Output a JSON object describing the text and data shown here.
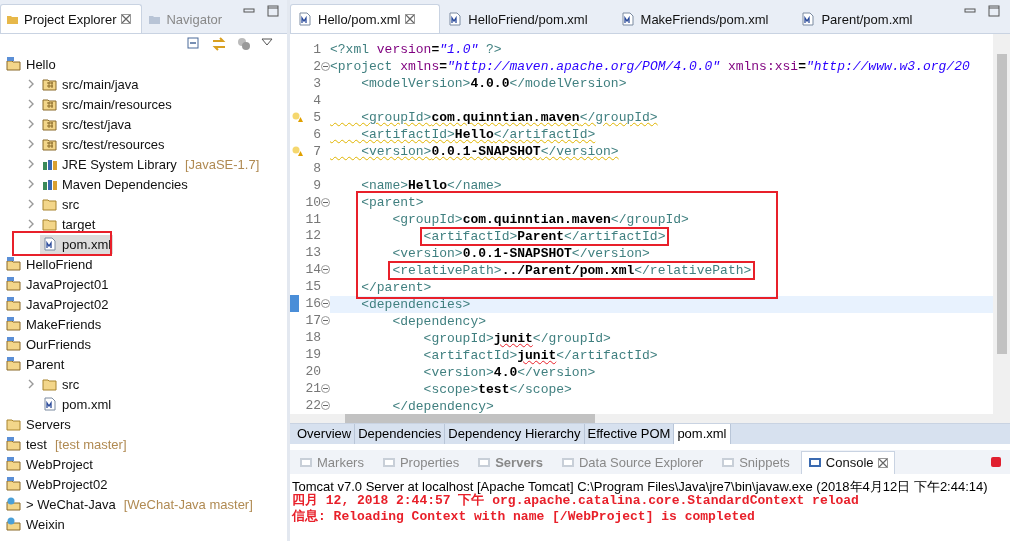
{
  "explorer": {
    "tabs": [
      {
        "label": "Project Explorer",
        "selected": true
      },
      {
        "label": "Navigator",
        "selected": false
      }
    ],
    "tree": [
      {
        "label": "Hello",
        "kind": "project",
        "children": [
          {
            "label": "src/main/java",
            "kind": "package",
            "collapsed_arrow": true
          },
          {
            "label": "src/main/resources",
            "kind": "package",
            "collapsed_arrow": true
          },
          {
            "label": "src/test/java",
            "kind": "package",
            "collapsed_arrow": true
          },
          {
            "label": "src/test/resources",
            "kind": "package",
            "collapsed_arrow": true
          },
          {
            "label": "JRE System Library",
            "decoration": "[JavaSE-1.7]",
            "kind": "library",
            "collapsed_arrow": true
          },
          {
            "label": "Maven Dependencies",
            "kind": "library",
            "collapsed_arrow": true
          },
          {
            "label": "src",
            "kind": "folder",
            "collapsed_arrow": true
          },
          {
            "label": "target",
            "kind": "folder",
            "collapsed_arrow": true
          },
          {
            "label": "pom.xml",
            "kind": "file",
            "selected": true,
            "boxed": true
          }
        ]
      },
      {
        "label": "HelloFriend",
        "kind": "project"
      },
      {
        "label": "JavaProject01",
        "kind": "project"
      },
      {
        "label": "JavaProject02",
        "kind": "project"
      },
      {
        "label": "MakeFriends",
        "kind": "project"
      },
      {
        "label": "OurFriends",
        "kind": "project"
      },
      {
        "label": "Parent",
        "kind": "project",
        "children": [
          {
            "label": "src",
            "kind": "folder",
            "collapsed_arrow": true
          },
          {
            "label": "pom.xml",
            "kind": "file"
          }
        ]
      },
      {
        "label": "Servers",
        "kind": "folder"
      },
      {
        "label": "test",
        "decoration": "[test master]",
        "kind": "project"
      },
      {
        "label": "WebProject",
        "kind": "project"
      },
      {
        "label": "WebProject02",
        "kind": "project"
      },
      {
        "label": "> WeChat-Java",
        "decoration": "[WeChat-Java master]",
        "kind": "web"
      },
      {
        "label": "Weixin",
        "kind": "web"
      }
    ]
  },
  "editor": {
    "tabs": [
      {
        "label": "Hello/pom.xml",
        "selected": true
      },
      {
        "label": "HelloFriend/pom.xml",
        "selected": false
      },
      {
        "label": "MakeFriends/pom.xml",
        "selected": false
      },
      {
        "label": "Parent/pom.xml",
        "selected": false
      }
    ],
    "lines": [
      {
        "number": "1",
        "tokens": [
          {
            "kind": "tag",
            "text": "<?xml "
          },
          {
            "kind": "attr",
            "text": "version"
          },
          {
            "kind": "text",
            "text": "="
          },
          {
            "kind": "string",
            "text": "\"1.0\""
          },
          {
            "kind": "tag",
            "text": " ?>"
          }
        ]
      },
      {
        "number": "2",
        "fold": true,
        "tokens": [
          {
            "kind": "tag",
            "text": "<project "
          },
          {
            "kind": "attr",
            "text": "xmlns"
          },
          {
            "kind": "text",
            "text": "="
          },
          {
            "kind": "string",
            "text": "\"http://maven.apache.org/POM/4.0.0\" "
          },
          {
            "kind": "attr",
            "text": "xmlns:xsi"
          },
          {
            "kind": "text",
            "text": "="
          },
          {
            "kind": "string",
            "text": "\"http://www.w3.org/20"
          }
        ]
      },
      {
        "number": "3",
        "tokens": [
          {
            "kind": "tag",
            "text": "    <modelVersion>"
          },
          {
            "kind": "text",
            "text": "4.0.0"
          },
          {
            "kind": "tag",
            "text": "</modelVersion>"
          }
        ]
      },
      {
        "number": "4"
      },
      {
        "number": "5",
        "warning": true,
        "tokens": [
          {
            "kind": "tag",
            "text": "    <groupId>",
            "warned": true
          },
          {
            "kind": "text",
            "text": "com.quinntian.maven",
            "warned": true
          },
          {
            "kind": "tag",
            "text": "</groupId>",
            "warned": true
          }
        ]
      },
      {
        "number": "6",
        "tokens": [
          {
            "kind": "tag",
            "text": "    <artifactId>",
            "warned": true
          },
          {
            "kind": "text",
            "text": "Hello",
            "warned": true
          },
          {
            "kind": "tag",
            "text": "</artifactId>",
            "warned": true
          }
        ]
      },
      {
        "number": "7",
        "warning": true,
        "tokens": [
          {
            "kind": "tag",
            "text": "    <version>",
            "warned": true
          },
          {
            "kind": "text",
            "text": "0.0.1-SNAPSHOT",
            "warned": true
          },
          {
            "kind": "tag",
            "text": "</version>",
            "warned": true
          }
        ]
      },
      {
        "number": "8"
      },
      {
        "number": "9",
        "tokens": [
          {
            "kind": "tag",
            "text": "    <name>"
          },
          {
            "kind": "text",
            "text": "Hello"
          },
          {
            "kind": "tag",
            "text": "</name>"
          }
        ]
      },
      {
        "kind": "framed_block",
        "lines": [
          {
            "number": "10",
            "fold": true,
            "tokens": [
              {
                "kind": "tag",
                "text": "    <parent>"
              }
            ]
          },
          {
            "number": "11",
            "tokens": [
              {
                "kind": "tag",
                "text": "        <groupId>"
              },
              {
                "kind": "text",
                "text": "com.quinntian.maven"
              },
              {
                "kind": "tag",
                "text": "</groupId>"
              }
            ]
          },
          {
            "number": "12",
            "boxed": true,
            "tokens": [
              {
                "kind": "tag",
                "text": "            <artifactId>"
              },
              {
                "kind": "text",
                "text": "Parent"
              },
              {
                "kind": "tag",
                "text": "</artifactId>"
              }
            ]
          },
          {
            "number": "13",
            "tokens": [
              {
                "kind": "tag",
                "text": "        <version>"
              },
              {
                "kind": "text",
                "text": "0.0.1-SNAPSHOT"
              },
              {
                "kind": "tag",
                "text": "</version>"
              }
            ]
          },
          {
            "number": "14",
            "fold": true,
            "boxed": true,
            "tokens": [
              {
                "kind": "tag",
                "text": "        <relativePath>"
              },
              {
                "kind": "text",
                "text": "../Parent/pom.xml"
              },
              {
                "kind": "tag",
                "text": "</relativePath>"
              }
            ]
          },
          {
            "number": "15",
            "tokens": [
              {
                "kind": "tag",
                "text": "    </parent>"
              }
            ]
          }
        ]
      },
      {
        "number": "16",
        "fold": true,
        "current": true,
        "tokens": [
          {
            "kind": "tag",
            "text": "    <dependencies>"
          }
        ]
      },
      {
        "number": "17",
        "fold": true,
        "tokens": [
          {
            "kind": "tag",
            "text": "        <dependency>"
          }
        ]
      },
      {
        "number": "18",
        "tokens": [
          {
            "kind": "tag",
            "text": "            <groupId>"
          },
          {
            "kind": "text",
            "text": "junit",
            "misspelled": true
          },
          {
            "kind": "tag",
            "text": "</groupId>"
          }
        ]
      },
      {
        "number": "19",
        "tokens": [
          {
            "kind": "tag",
            "text": "            <artifactId>"
          },
          {
            "kind": "text",
            "text": "junit",
            "misspelled": true
          },
          {
            "kind": "tag",
            "text": "</artifactId>"
          }
        ]
      },
      {
        "number": "20",
        "tokens": [
          {
            "kind": "tag",
            "text": "            <version>"
          },
          {
            "kind": "text",
            "text": "4.0"
          },
          {
            "kind": "tag",
            "text": "</version>"
          }
        ]
      },
      {
        "number": "21",
        "fold": true,
        "tokens": [
          {
            "kind": "tag",
            "text": "            <scope>"
          },
          {
            "kind": "text",
            "text": "test"
          },
          {
            "kind": "tag",
            "text": "</scope>"
          }
        ]
      },
      {
        "number": "22",
        "fold": true,
        "tokens": [
          {
            "kind": "tag",
            "text": "        </dependency>"
          }
        ]
      }
    ],
    "page_tabs": [
      {
        "label": "Overview",
        "selected": false
      },
      {
        "label": "Dependencies",
        "selected": false
      },
      {
        "label": "Dependency Hierarchy",
        "selected": false
      },
      {
        "label": "Effective POM",
        "selected": false
      },
      {
        "label": "pom.xml",
        "selected": true
      }
    ]
  },
  "console": {
    "tabs": [
      {
        "label": "Markers",
        "selected": false,
        "emphasized": false
      },
      {
        "label": "Properties",
        "selected": false,
        "emphasized": false
      },
      {
        "label": "Servers",
        "selected": false,
        "emphasized": true
      },
      {
        "label": "Data Source Explorer",
        "selected": false,
        "emphasized": false
      },
      {
        "label": "Snippets",
        "selected": false,
        "emphasized": false
      },
      {
        "label": "Console",
        "selected": true,
        "emphasized": false
      }
    ],
    "title": "Tomcat v7.0 Server at localhost [Apache Tomcat] C:\\Program Files\\Java\\jre7\\bin\\javaw.exe (2018年4月12日 下午2:44:14)",
    "lines": [
      "四月 12, 2018 2:44:57 下午 org.apache.catalina.core.StandardContext reload",
      "信息: Reloading Context with name [/WebProject] is completed"
    ]
  }
}
